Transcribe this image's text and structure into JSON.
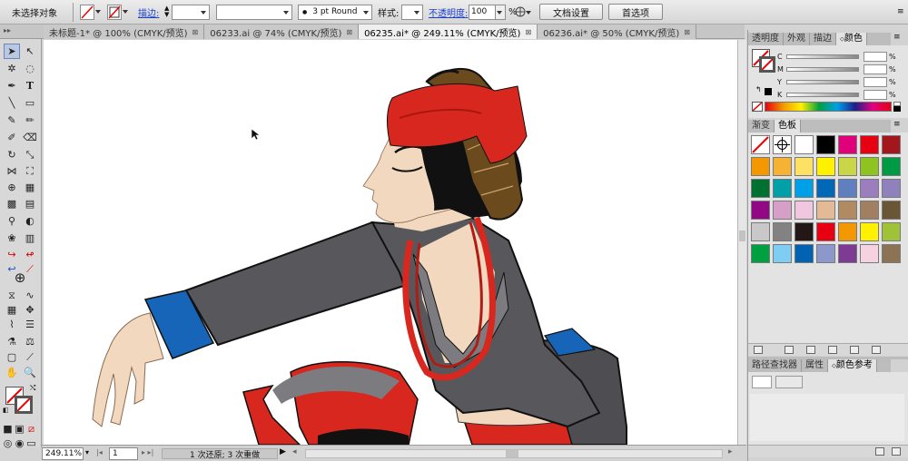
{
  "control_bar": {
    "selection_status": "未选择对象",
    "stroke_label": "描边:",
    "brush_value": "3 pt Round",
    "style_label": "样式:",
    "opacity_label": "不透明度:",
    "opacity_value": "100",
    "opacity_unit": "%",
    "doc_setup_button": "文档设置",
    "preferences_button": "首选项"
  },
  "doc_tabs": [
    {
      "label": "未标题-1* @ 100% (CMYK/预览)",
      "active": false
    },
    {
      "label": "06233.ai @ 74% (CMYK/预览)",
      "active": false
    },
    {
      "label": "06235.ai* @ 249.11% (CMYK/预览)",
      "active": true
    },
    {
      "label": "06236.ai* @ 50% (CMYK/预览)",
      "active": false
    }
  ],
  "tab_close_glyph": "⊠",
  "status_bar": {
    "zoom": "249.11%",
    "page": "1",
    "history": "1 次还原; 3 次重做"
  },
  "color_panel": {
    "tabs": [
      "透明度",
      "外观",
      "描边",
      "颜色"
    ],
    "channels": [
      "C",
      "M",
      "Y",
      "K"
    ],
    "unit": "%"
  },
  "swatches_panel": {
    "tabs": [
      "渐变",
      "色板"
    ],
    "colors": [
      "none",
      "registration",
      "#ffffff",
      "#000000",
      "#e0007a",
      "#e60012",
      "#a3161b",
      "#f39800",
      "#f5b233",
      "#fde164",
      "#fff100",
      "#c9d647",
      "#8fc31f",
      "#009944",
      "#007130",
      "#00a0a8",
      "#00a0e9",
      "#0068b7",
      "#5f7fbf",
      "#9c7ebf",
      "#8f82bc",
      "#920783",
      "#d59fc8",
      "#f1c6df",
      "#e4b995",
      "#b08a63",
      "#a08060",
      "#6a5536",
      "#c8c8c8",
      "#828282",
      "#231815",
      "#e60012",
      "#f39800",
      "#fff100",
      "#a0c238",
      "#00a040",
      "#7ecef4",
      "#0062b0",
      "#8c97cb",
      "#7d3b93",
      "#f6d2e0",
      "#8c7353"
    ]
  },
  "bottom_panel": {
    "tabs": [
      "路径查找器",
      "属性",
      "颜色参考"
    ]
  },
  "accent_colors": {
    "headband_red": "#d8271e",
    "jacket_gray": "#5a5a5e",
    "cuff_blue": "#1765b8",
    "skin": "#f3d8c0",
    "braid_brown": "#6b4a1e"
  }
}
